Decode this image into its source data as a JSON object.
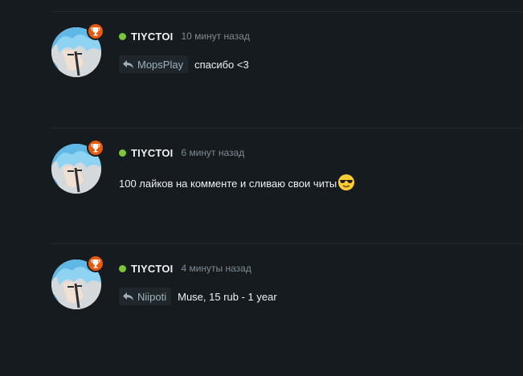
{
  "comments": [
    {
      "username": "TIYCTOI",
      "time": "10 минут назад",
      "reply_to": "MopsPlay",
      "text": "спасибо <3"
    },
    {
      "username": "TIYCTOI",
      "time": "6 минут назад",
      "text": "100 лайков на комменте и сливаю свои читы"
    },
    {
      "username": "TIYCTOI",
      "time": "4 минуты назад",
      "reply_to": "Niipoti",
      "text": "Muse, 15 rub - 1 year"
    }
  ],
  "icons": {
    "badge": "trophy-icon",
    "reply": "reply-arrow-icon",
    "online": "online-status-dot",
    "emoji": "sunglasses-emoji"
  },
  "colors": {
    "background": "#161b1f",
    "online": "#7cc53a",
    "badge": "#e8590c"
  }
}
